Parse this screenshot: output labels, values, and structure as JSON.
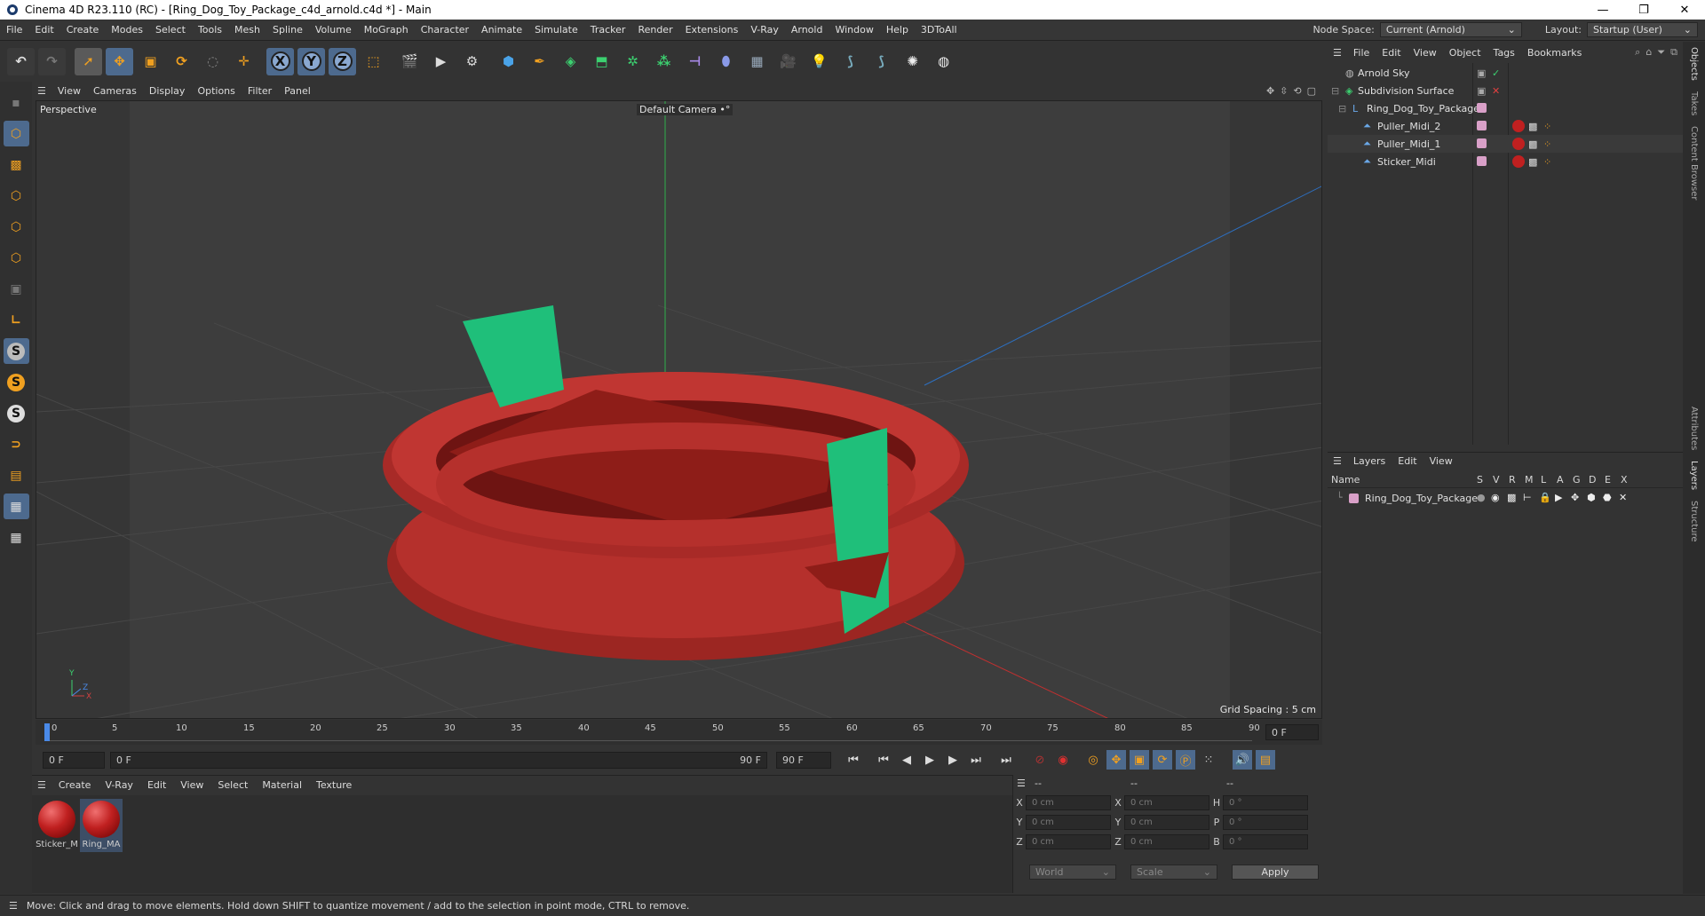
{
  "window": {
    "title": "Cinema 4D R23.110 (RC) - [Ring_Dog_Toy_Package_c4d_arnold.c4d *] - Main",
    "minimize": "—",
    "maximize": "❐",
    "close": "✕"
  },
  "menubar": {
    "items": [
      "File",
      "Edit",
      "Create",
      "Modes",
      "Select",
      "Tools",
      "Mesh",
      "Spline",
      "Volume",
      "MoGraph",
      "Character",
      "Animate",
      "Simulate",
      "Tracker",
      "Render",
      "Extensions",
      "V-Ray",
      "Arnold",
      "Window",
      "Help",
      "3DToAll"
    ],
    "node_space_label": "Node Space:",
    "node_space_value": "Current (Arnold)",
    "layout_label": "Layout:",
    "layout_value": "Startup (User)"
  },
  "toolbar": {
    "axis_x": "X",
    "axis_y": "Y",
    "axis_z": "Z"
  },
  "viewport": {
    "menu": [
      "View",
      "Cameras",
      "Display",
      "Options",
      "Filter",
      "Panel"
    ],
    "label": "Perspective",
    "camera": "Default Camera",
    "camera_suffix": "•°",
    "grid_spacing": "Grid Spacing : 5 cm",
    "axis_y": "Y",
    "axis_z": "Z",
    "axis_x": "X"
  },
  "timeline": {
    "ticks": [
      "0",
      "5",
      "10",
      "15",
      "20",
      "25",
      "30",
      "35",
      "40",
      "45",
      "50",
      "55",
      "60",
      "65",
      "70",
      "75",
      "80",
      "85",
      "90"
    ],
    "current_frame": "0 F"
  },
  "transport": {
    "start_field": "0 F",
    "range_start": "0 F",
    "range_end": "90 F",
    "end_field": "90 F"
  },
  "materials": {
    "menu": [
      "Create",
      "V-Ray",
      "Edit",
      "View",
      "Select",
      "Material",
      "Texture"
    ],
    "items": [
      {
        "label": "Sticker_M"
      },
      {
        "label": "Ring_MA"
      }
    ]
  },
  "coordinates": {
    "header": [
      "--",
      "--",
      "--"
    ],
    "rows": [
      {
        "l1": "X",
        "v1": "0 cm",
        "l2": "X",
        "v2": "0 cm",
        "l3": "H",
        "v3": "0 °"
      },
      {
        "l1": "Y",
        "v1": "0 cm",
        "l2": "Y",
        "v2": "0 cm",
        "l3": "P",
        "v3": "0 °"
      },
      {
        "l1": "Z",
        "v1": "0 cm",
        "l2": "Z",
        "v2": "0 cm",
        "l3": "B",
        "v3": "0 °"
      }
    ],
    "mode1": "World",
    "mode2": "Scale",
    "apply": "Apply"
  },
  "objects": {
    "menu": [
      "File",
      "Edit",
      "View",
      "Object",
      "Tags",
      "Bookmarks"
    ],
    "items": [
      {
        "name": "Arnold Sky"
      },
      {
        "name": "Subdivision Surface"
      },
      {
        "name": "Ring_Dog_Toy_Package"
      },
      {
        "name": "Puller_Midi_2"
      },
      {
        "name": "Puller_Midi_1"
      },
      {
        "name": "Sticker_Midi"
      }
    ]
  },
  "layers": {
    "menu": [
      "Layers",
      "Edit",
      "View"
    ],
    "col_name": "Name",
    "col_flags": [
      "S",
      "V",
      "R",
      "M",
      "L",
      "A",
      "G",
      "D",
      "E",
      "X"
    ],
    "items": [
      {
        "name": "Ring_Dog_Toy_Package"
      }
    ]
  },
  "side_tabs": [
    "Objects",
    "Takes",
    "Content Browser",
    "Attributes",
    "Layers",
    "Structure"
  ],
  "status": {
    "text": "Move: Click and drag to move elements. Hold down SHIFT to quantize movement / add to the selection in point mode, CTRL to remove."
  },
  "colors": {
    "ring_red": "#b5302c",
    "sticker_green": "#1fbf7a",
    "accent_orange": "#f0a020",
    "layer_swatch": "#d9a0c8"
  }
}
